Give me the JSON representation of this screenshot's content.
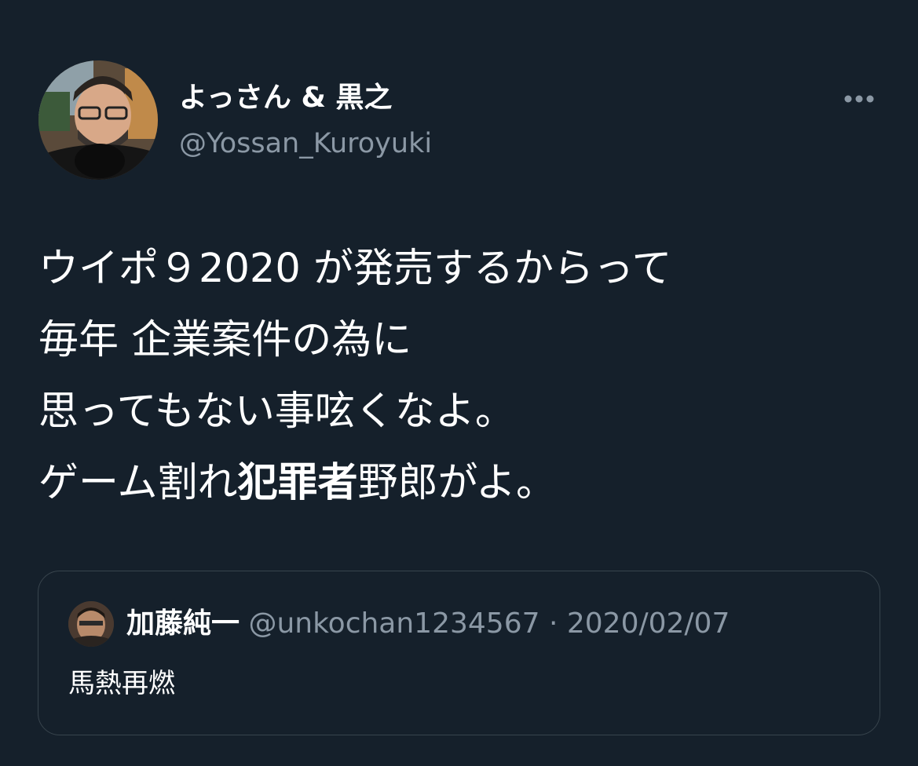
{
  "author": {
    "display_name": "よっさん & 黒之",
    "handle": "@Yossan_Kuroyuki"
  },
  "more_icon": "ellipsis-horizontal-icon",
  "tweet": {
    "lines": [
      [
        "ウイポ９2020 が発売するからって"
      ],
      [
        "毎年 企業案件の為に"
      ],
      [
        "思ってもない事呟くなよ。"
      ],
      [
        "ゲーム割れ",
        "犯罪者",
        "野郎がよ。"
      ]
    ],
    "line1": "ウイポ９2020 が発売するからって",
    "line2": "毎年 企業案件の為に",
    "line3": "思ってもない事呟くなよ。",
    "line4_a": "ゲーム割れ",
    "line4_bold": "犯罪者",
    "line4_b": "野郎がよ。"
  },
  "quoted_tweet": {
    "display_name": "加藤純一",
    "handle": "@unkochan1234567",
    "separator": "·",
    "date": "2020/02/07",
    "text": "馬熱再燃"
  },
  "colors": {
    "background": "#15202b",
    "secondary_text": "#8b98a5",
    "border": "#38444d"
  }
}
